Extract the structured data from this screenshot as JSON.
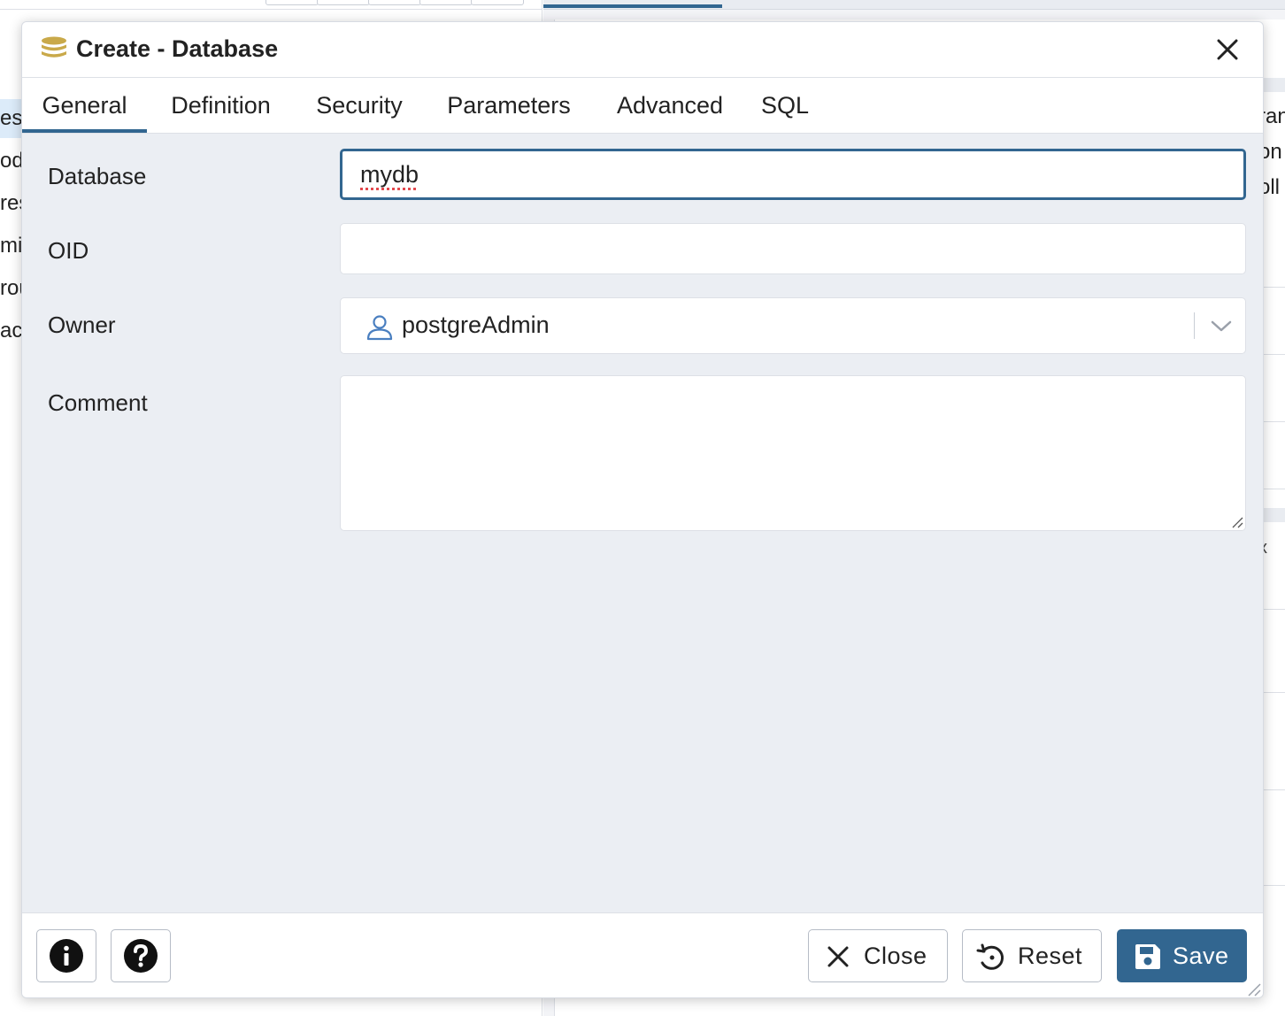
{
  "background": {
    "tree_fragments": [
      "es",
      "od",
      "res",
      "mi",
      "rou",
      "ace"
    ],
    "right_fragments": [
      "ran",
      "on",
      "oll",
      "x"
    ]
  },
  "dialog": {
    "title": "Create - Database",
    "tabs": [
      {
        "label": "General"
      },
      {
        "label": "Definition"
      },
      {
        "label": "Security"
      },
      {
        "label": "Parameters"
      },
      {
        "label": "Advanced"
      },
      {
        "label": "SQL"
      }
    ],
    "active_tab": "General",
    "fields": {
      "database": {
        "label": "Database",
        "value": "mydb"
      },
      "oid": {
        "label": "OID",
        "value": ""
      },
      "owner": {
        "label": "Owner",
        "value": "postgreAdmin"
      },
      "comment": {
        "label": "Comment",
        "value": ""
      }
    },
    "footer": {
      "close_label": "Close",
      "reset_label": "Reset",
      "save_label": "Save"
    }
  },
  "colors": {
    "accent": "#326690",
    "dialog_bg": "#ebeef3",
    "db_icon": "#c9a94a",
    "user_icon": "#4a7fc0"
  },
  "icons": {
    "title": "database-icon",
    "close": "close-icon",
    "owner": "user-icon",
    "dropdown": "chevron-down-icon",
    "info": "info-icon",
    "help": "help-icon",
    "reset": "reset-icon",
    "save": "save-icon"
  }
}
